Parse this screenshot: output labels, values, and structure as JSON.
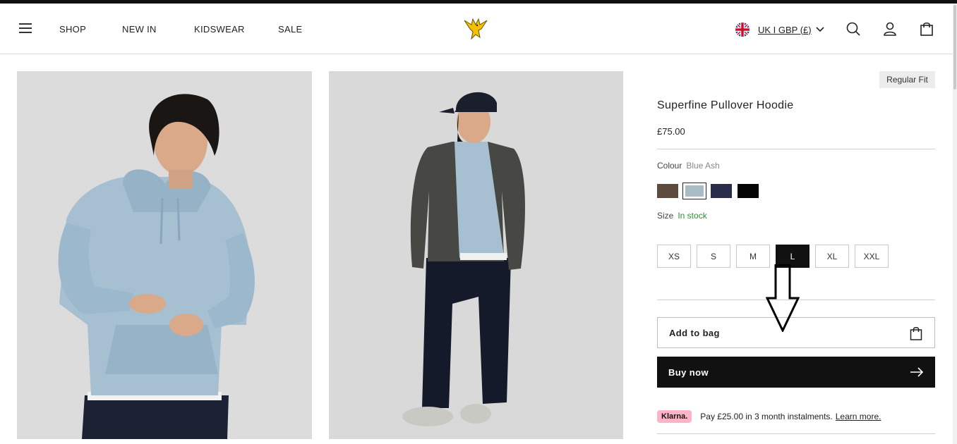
{
  "header": {
    "nav": [
      "SHOP",
      "NEW IN",
      "KIDSWEAR",
      "SALE"
    ],
    "currency": "UK I GBP (£)",
    "icons": [
      "menu-icon",
      "eagle-logo",
      "uk-flag-icon",
      "search-icon",
      "account-icon",
      "bag-icon"
    ]
  },
  "product": {
    "fit_badge": "Regular Fit",
    "title": "Superfine Pullover Hoodie",
    "price": "£75.00",
    "colour_label": "Colour",
    "colour_value": "Blue Ash",
    "swatch_colors": [
      "#5c4a3f",
      "#a9bbc6",
      "#2a2d4a",
      "#050505"
    ],
    "selected_swatch_index": 1,
    "size_label": "Size",
    "stock_status": "In stock",
    "sizes": [
      "XS",
      "S",
      "M",
      "L",
      "XL",
      "XXL"
    ],
    "selected_size": "L",
    "add_to_bag": "Add to bag",
    "buy_now": "Buy now",
    "klarna_badge": "Klarna.",
    "klarna_text": "Pay £25.00 in 3 month instalments.",
    "klarna_link": "Learn more."
  },
  "colors": {
    "accent": "#111111",
    "stock_green": "#2e8b3a",
    "klarna_pink": "#ffb3c7",
    "logo_yellow": "#f2c200"
  }
}
